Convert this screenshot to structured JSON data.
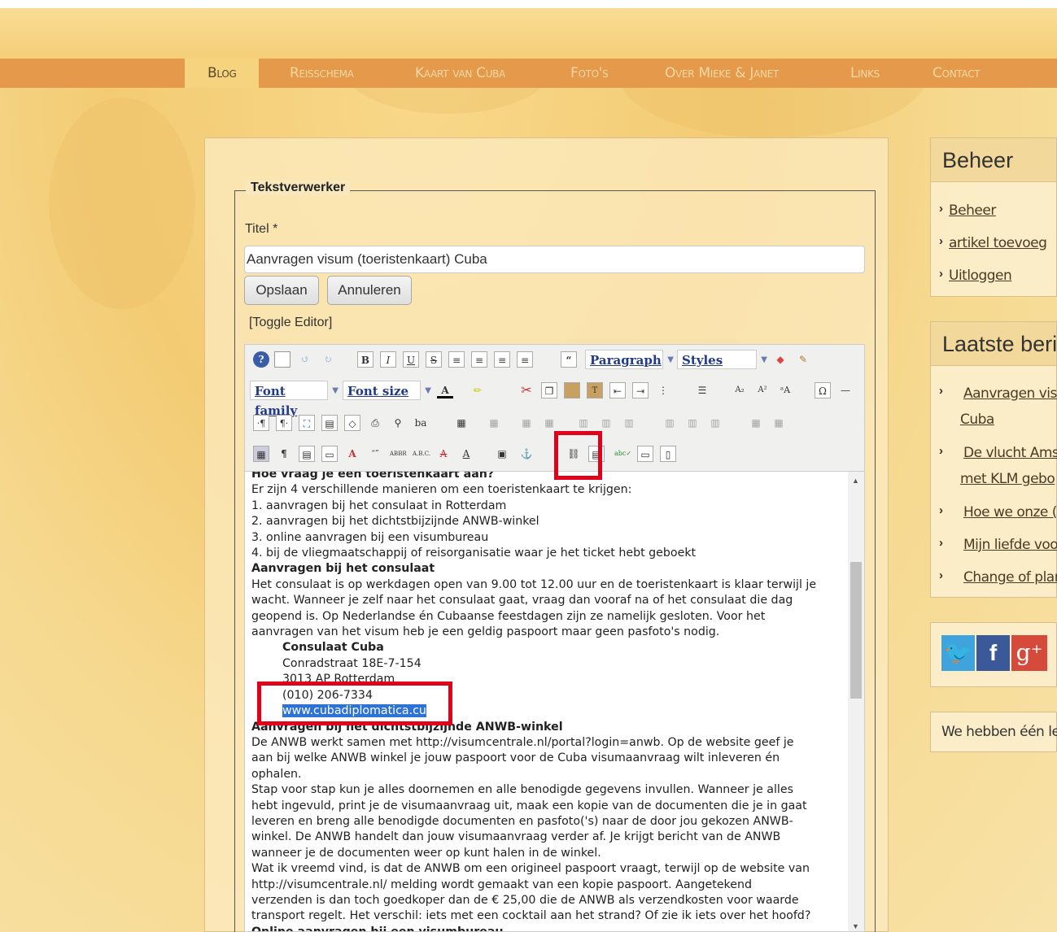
{
  "nav": {
    "items": [
      "Blog",
      "Reisschema",
      "Kaart van Cuba",
      "Foto's",
      "Over Mieke & Janet",
      "Links",
      "Contact"
    ]
  },
  "form": {
    "legend": "Tekstverwerker",
    "title_label": "Titel *",
    "title_value": "Aanvragen visum (toeristenkaart) Cuba",
    "save_label": "Opslaan",
    "cancel_label": "Annuleren",
    "toggle_label": "[Toggle Editor]"
  },
  "toolbar": {
    "format_select": "Paragraph",
    "styles_select": "Styles",
    "font_family": "Font family",
    "font_size": "Font size"
  },
  "editor": {
    "lines": [
      {
        "text": "Hoe vraag je een toeristenkaart aan?",
        "style": "b"
      },
      {
        "text": "Er zijn 4 verschillende manieren om een toeristenkaart te krijgen:",
        "style": ""
      },
      {
        "text": "1. aanvragen bij het consulaat in Rotterdam",
        "style": ""
      },
      {
        "text": "2. aanvragen bij het dichtstbijzijnde ANWB-winkel",
        "style": ""
      },
      {
        "text": "3. online aanvragen bij een visumbureau",
        "style": ""
      },
      {
        "text": "4. bij de vliegmaatschappij of reisorganisatie waar je het ticket hebt geboekt",
        "style": ""
      },
      {
        "text": "Aanvragen bij het consulaat",
        "style": "b"
      },
      {
        "text": "Het consulaat is op werkdagen open van 9.00 tot 12.00 uur en de toeristenkaart is klaar terwijl je",
        "style": ""
      },
      {
        "text": "wacht. Wanneer je zelf naar het consulaat gaat, vraag dan vooraf na of het consulaat die dag",
        "style": ""
      },
      {
        "text": "geopend is. Op Nederlandse én Cubaanse feestdagen zijn ze namelijk gesloten. Voor het",
        "style": ""
      },
      {
        "text": "aanvragen van het visum heb je een geldig paspoort maar geen pasfoto's nodig.",
        "style": ""
      },
      {
        "text": "Consulaat Cuba",
        "style": "b indent"
      },
      {
        "text": "Conradstraat 18E-7-154",
        "style": "indent"
      },
      {
        "text": "3013 AP Rotterdam",
        "style": "indent"
      },
      {
        "text": "(010) 206-7334",
        "style": "indent"
      },
      {
        "text": "www.cubadiplomatica.cu",
        "style": "indent sel"
      },
      {
        "text": "Aanvragen bij het dichtstbijzijnde ANWB-winkel",
        "style": "b"
      },
      {
        "text": "De ANWB werkt samen met http://visumcentrale.nl/portal?login=anwb. Op de website geef je",
        "style": ""
      },
      {
        "text": "aan bij welke ANWB winkel je jouw paspoort voor de Cuba visumaanvraag wilt inleveren én",
        "style": ""
      },
      {
        "text": "ophalen.",
        "style": ""
      },
      {
        "text": "Stap voor stap kun je alles doornemen en alle benodigde gegevens invullen. Wanneer je alles",
        "style": ""
      },
      {
        "text": "hebt ingevuld, print je de visumaanvraag uit, maak een kopie van de documenten die je in gaat",
        "style": ""
      },
      {
        "text": "leveren en breng alle benodigde documenten en pasfoto('s) naar de door jou gekozen ANWB-",
        "style": ""
      },
      {
        "text": "winkel. De ANWB handelt dan jouw visumaanvraag verder af. Je krijgt bericht van de ANWB",
        "style": ""
      },
      {
        "text": "wanneer je de documenten weer op kunt halen in de winkel.",
        "style": ""
      },
      {
        "text": "Wat ik vreemd vind, is dat de ANWB om een origineel paspoort vraagt, terwijl op de website van",
        "style": ""
      },
      {
        "text": "http://visumcentrale.nl/ melding wordt gemaakt van een kopie paspoort. Aangetekend",
        "style": ""
      },
      {
        "text": "verzenden is dan toch goedkoper dan de € 25,00 die de ANWB als verzendkosten voor waarde",
        "style": ""
      },
      {
        "text": "transport regelt. Het verschil: iets met een cocktail aan het strand? Of zie ik iets over het hoofd?",
        "style": ""
      },
      {
        "text": "Online aanvragen bij een visumbureau",
        "style": "b"
      }
    ]
  },
  "sidebar": {
    "beheer_title": "Beheer",
    "beheer_links": [
      "Beheer",
      "artikel toevoeg",
      "Uitloggen"
    ],
    "recent_title": "Laatste beri",
    "recent_links": [
      "Aanvragen vis",
      "Cuba",
      "De vlucht Ams",
      "met KLM gebo",
      "Hoe we onze (",
      "Mijn liefde voo",
      "Change of plar"
    ],
    "social": {
      "twitter": "twitter-icon",
      "facebook": "facebook-icon",
      "google": "google-plus-icon"
    },
    "footer_text": "We hebben één le"
  },
  "colors": {
    "nav_bg": "#e49a4a",
    "highlight_red": "#e0001a",
    "selection_blue": "#2d73d6"
  }
}
